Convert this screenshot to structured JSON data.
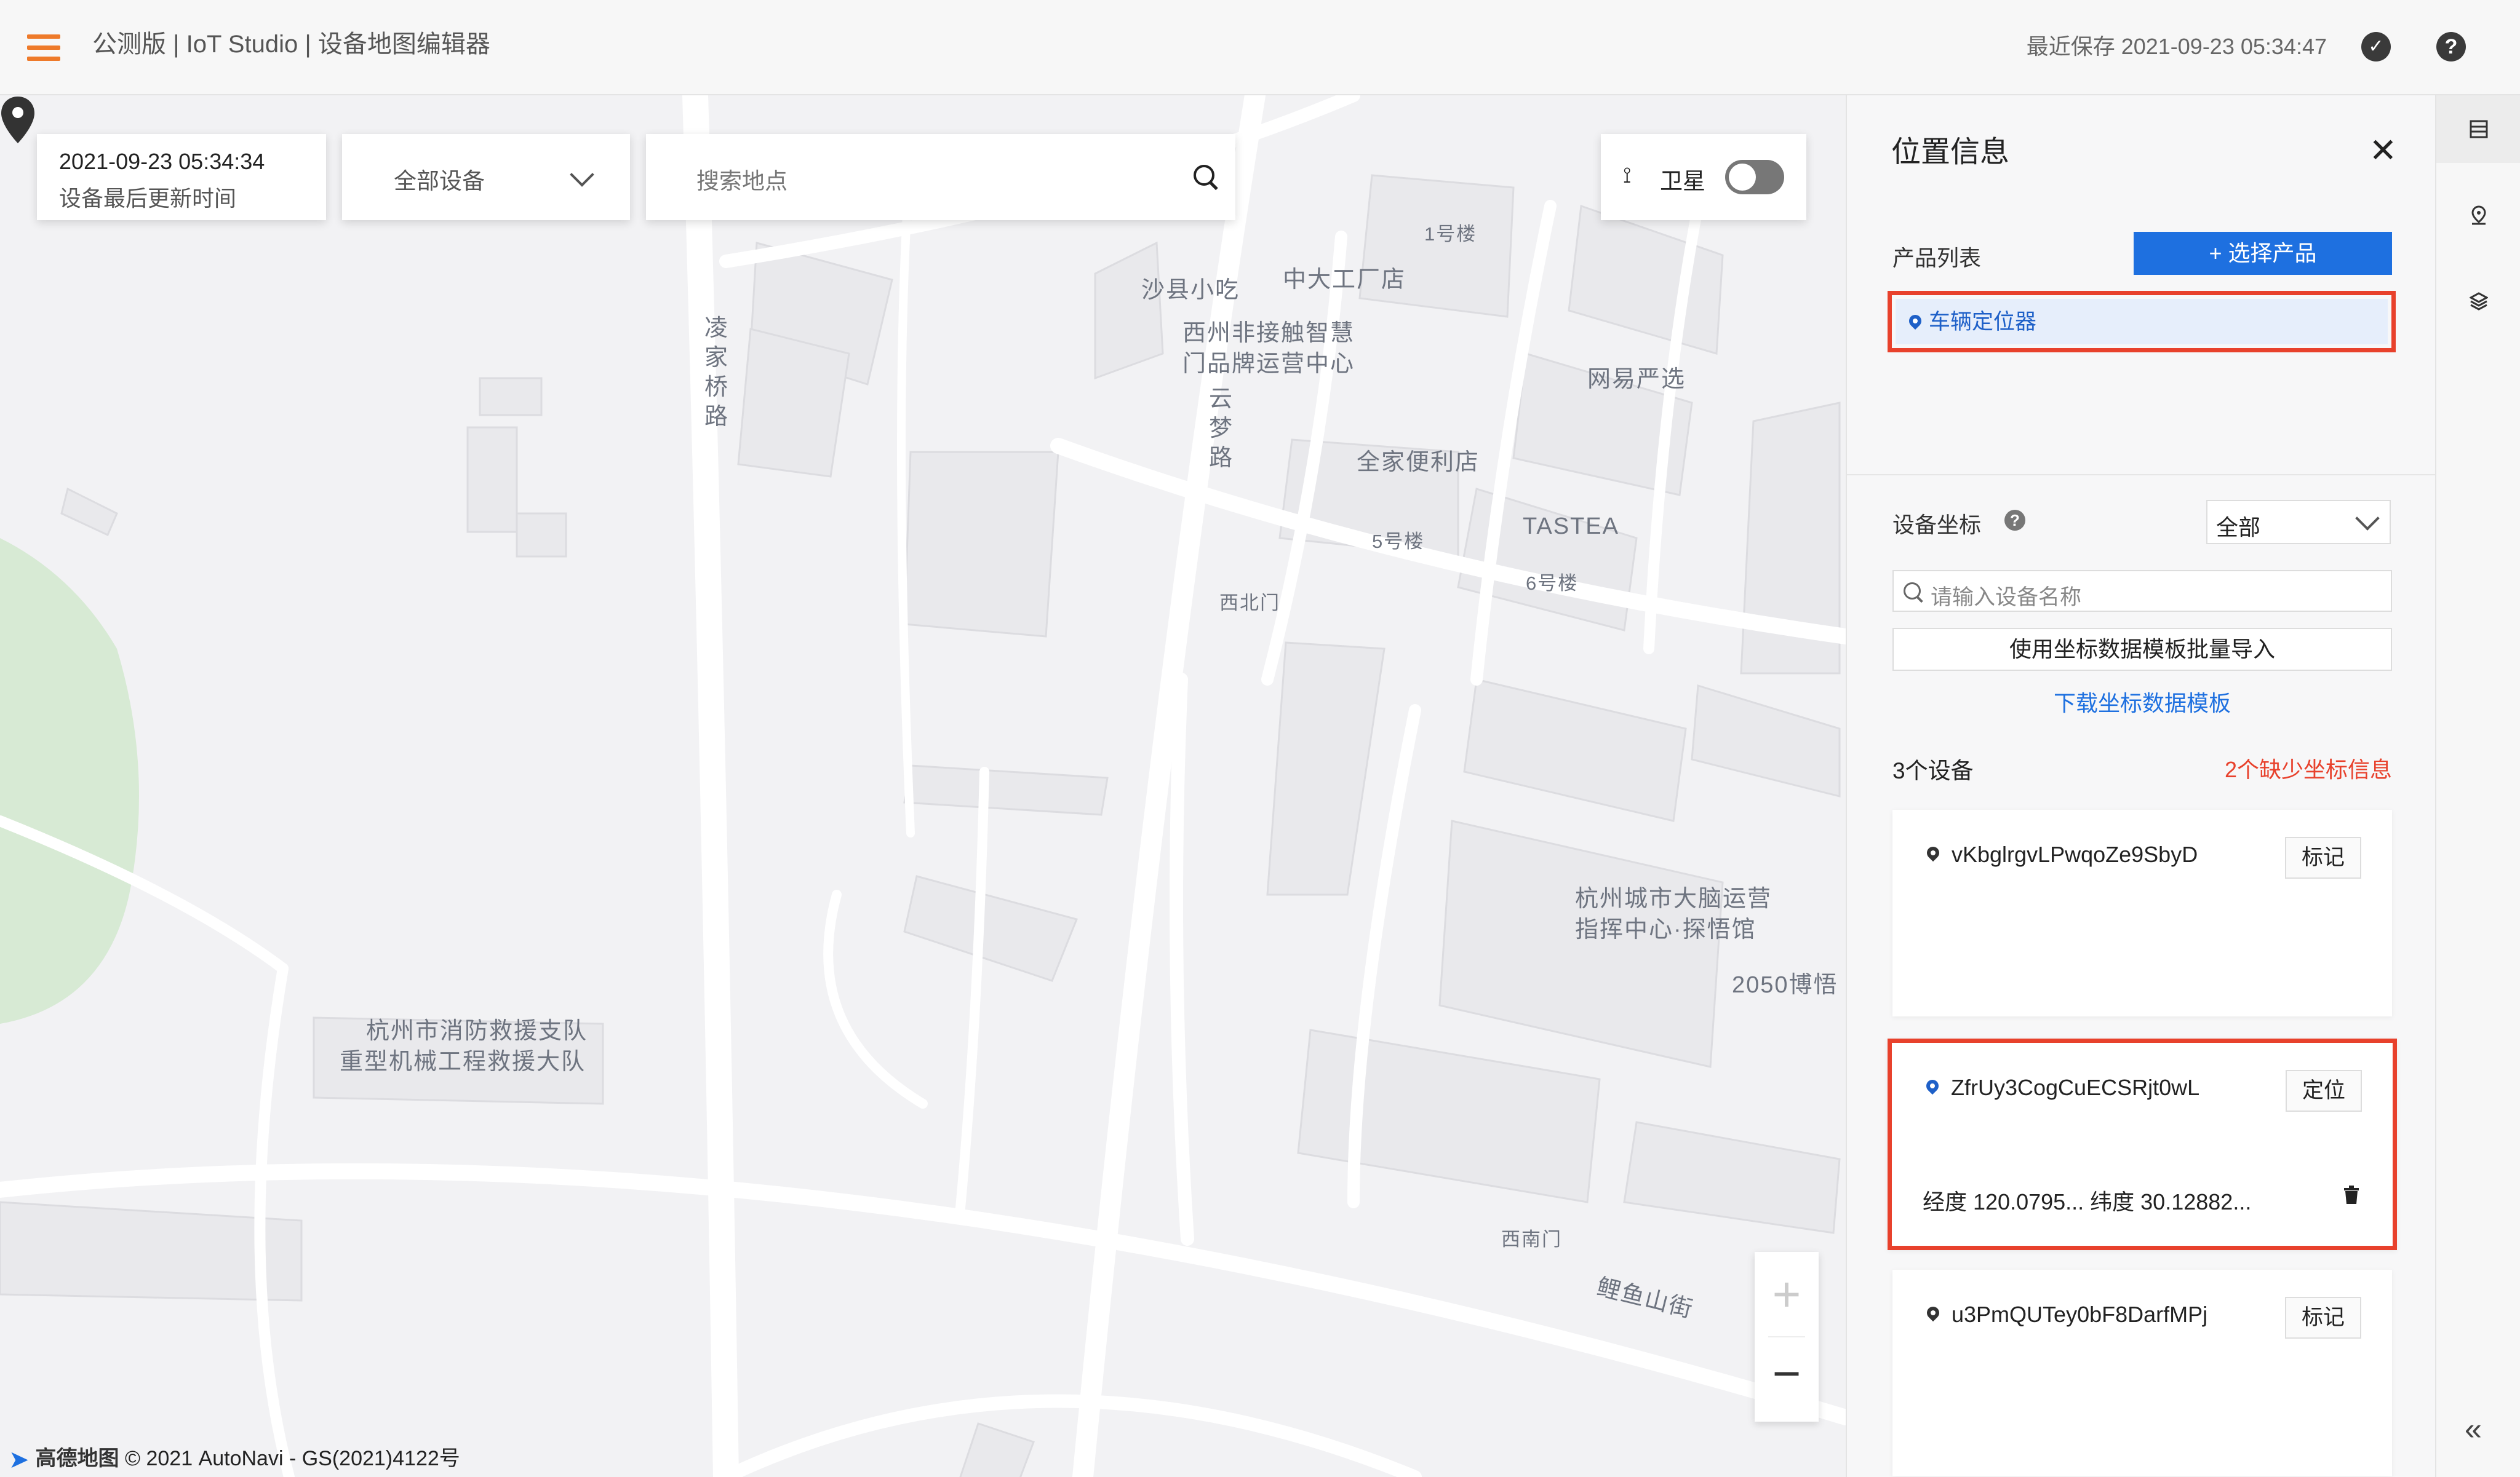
{
  "header": {
    "app_title": "公测版 | IoT Studio | 设备地图编辑器",
    "save_time": "最近保存 2021-09-23 05:34:47"
  },
  "map_toolbar": {
    "update_time": "2021-09-23 05:34:34",
    "update_time_label": "设备最后更新时间",
    "device_filter": "全部设备",
    "search_placeholder": "搜索地点",
    "satellite_label": "卫星",
    "satellite_on": false
  },
  "map": {
    "labels": {
      "lingjiaqiao_road": "凌家桥路",
      "yunmeng_road": "云梦路",
      "shaxian": "沙县小吃",
      "zhongdagongchang": "中大工厂店",
      "building1": "1号楼",
      "xizhou1": "西州非接触智慧",
      "xizhou2": "门品牌运营中心",
      "wangyi": "网易严选",
      "quanjia": "全家便利店",
      "building5": "5号楼",
      "tastea": "TASTEA",
      "building6": "6号楼",
      "xibeimen": "西北门",
      "citybrain1": "杭州城市大脑运营",
      "citybrain2": "指挥中心·探悟馆",
      "expo2050": "2050博悟",
      "fire1": "杭州市消防救援支队",
      "fire2": "重型机械工程救援大队",
      "xinanmen": "西南门",
      "liyushan_street": "鲤鱼山街"
    },
    "attribution_brand": "高德地图",
    "attribution_text": "© 2021 AutoNavi - GS(2021)4122号"
  },
  "panel": {
    "title": "位置信息",
    "product_list_label": "产品列表",
    "select_product_button": "+ 选择产品",
    "products": [
      "车辆定位器"
    ],
    "coord_label": "设备坐标",
    "coord_filter": "全部",
    "device_search_placeholder": "请输入设备名称",
    "batch_import_button": "使用坐标数据模板批量导入",
    "download_template_link": "下载坐标数据模板",
    "device_count": "3个设备",
    "missing_coords": "2个缺少坐标信息",
    "devices": [
      {
        "name": "vKbglrgvLPwqoZe9SbyD",
        "action": "标记"
      },
      {
        "name": "ZfrUy3CogCuECSRjt0wL",
        "action": "定位",
        "coords": "经度 120.0795...   纬度 30.12882..."
      },
      {
        "name": "u3PmQUTey0bF8DarfMPj",
        "action": "标记"
      }
    ]
  },
  "colors": {
    "accent": "#1e70e0",
    "highlight": "#e8412c",
    "menu_icon": "#ee7a2a"
  }
}
